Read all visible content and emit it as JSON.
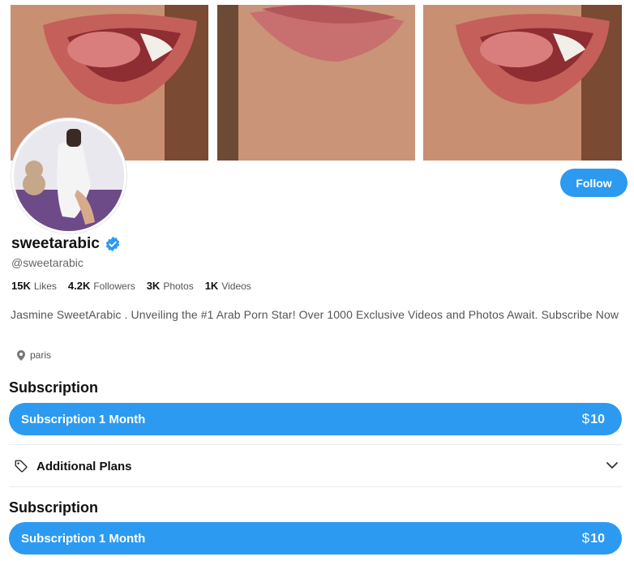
{
  "profile": {
    "name": "sweetarabic",
    "handle": "@sweetarabic",
    "verified": true,
    "follow_label": "Follow",
    "location": "paris",
    "bio": "Jasmine SweetArabic . Unveiling the #1 Arab Porn Star! Over 1000 Exclusive Videos and Photos Await. Subscribe Now"
  },
  "stats": [
    {
      "value": "15K",
      "label": "Likes"
    },
    {
      "value": "4.2K",
      "label": "Followers"
    },
    {
      "value": "3K",
      "label": "Photos"
    },
    {
      "value": "1K",
      "label": "Videos"
    }
  ],
  "subscriptions": [
    {
      "title": "Subscription",
      "button_label": "Subscription 1 Month",
      "currency": "$",
      "price": "10"
    },
    {
      "title": "Subscription",
      "button_label": "Subscription 1 Month",
      "currency": "$",
      "price": "10"
    }
  ],
  "additional_plans": {
    "label": "Additional Plans"
  },
  "colors": {
    "accent": "#2c9af0",
    "verified": "#2c9af0",
    "text_muted": "#666666"
  },
  "icons": [
    "verified-badge-icon",
    "location-pin-icon",
    "tag-icon",
    "chevron-down-icon"
  ]
}
